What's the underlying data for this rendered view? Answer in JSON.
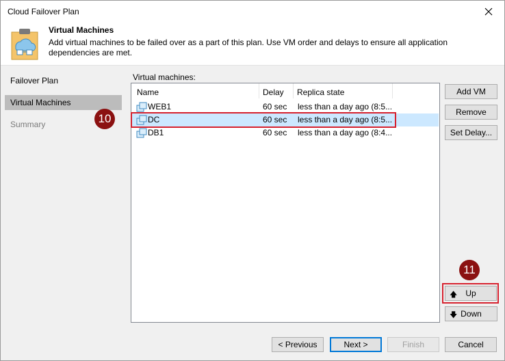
{
  "window": {
    "title": "Cloud Failover Plan"
  },
  "header": {
    "title": "Virtual Machines",
    "description": "Add virtual machines to be failed over as a part of this plan. Use VM order and delays to ensure all application dependencies are met."
  },
  "sidebar": {
    "items": [
      {
        "label": "Failover Plan",
        "state": "normal"
      },
      {
        "label": "Virtual Machines",
        "state": "active"
      },
      {
        "label": "Summary",
        "state": "disabled"
      }
    ]
  },
  "vm_section": {
    "label": "Virtual machines:",
    "columns": [
      "Name",
      "Delay",
      "Replica state"
    ],
    "rows": [
      {
        "name": "WEB1",
        "delay": "60 sec",
        "replica_state": "less than a day ago (8:5...",
        "selected": false
      },
      {
        "name": "DC",
        "delay": "60 sec",
        "replica_state": "less than a day ago (8:5...",
        "selected": true
      },
      {
        "name": "DB1",
        "delay": "60 sec",
        "replica_state": "less than a day ago (8:4...",
        "selected": false
      }
    ]
  },
  "side_buttons": {
    "add_vm": "Add VM",
    "remove": "Remove",
    "set_delay": "Set Delay...",
    "up": "Up",
    "down": "Down"
  },
  "footer": {
    "previous": "< Previous",
    "next": "Next >",
    "finish": "Finish",
    "cancel": "Cancel"
  },
  "annotations": {
    "step_a": "10",
    "step_b": "11"
  },
  "colors": {
    "highlight": "#d6212e",
    "badge": "#8b1111",
    "selection": "#cce8ff",
    "default_border": "#0078d7"
  }
}
